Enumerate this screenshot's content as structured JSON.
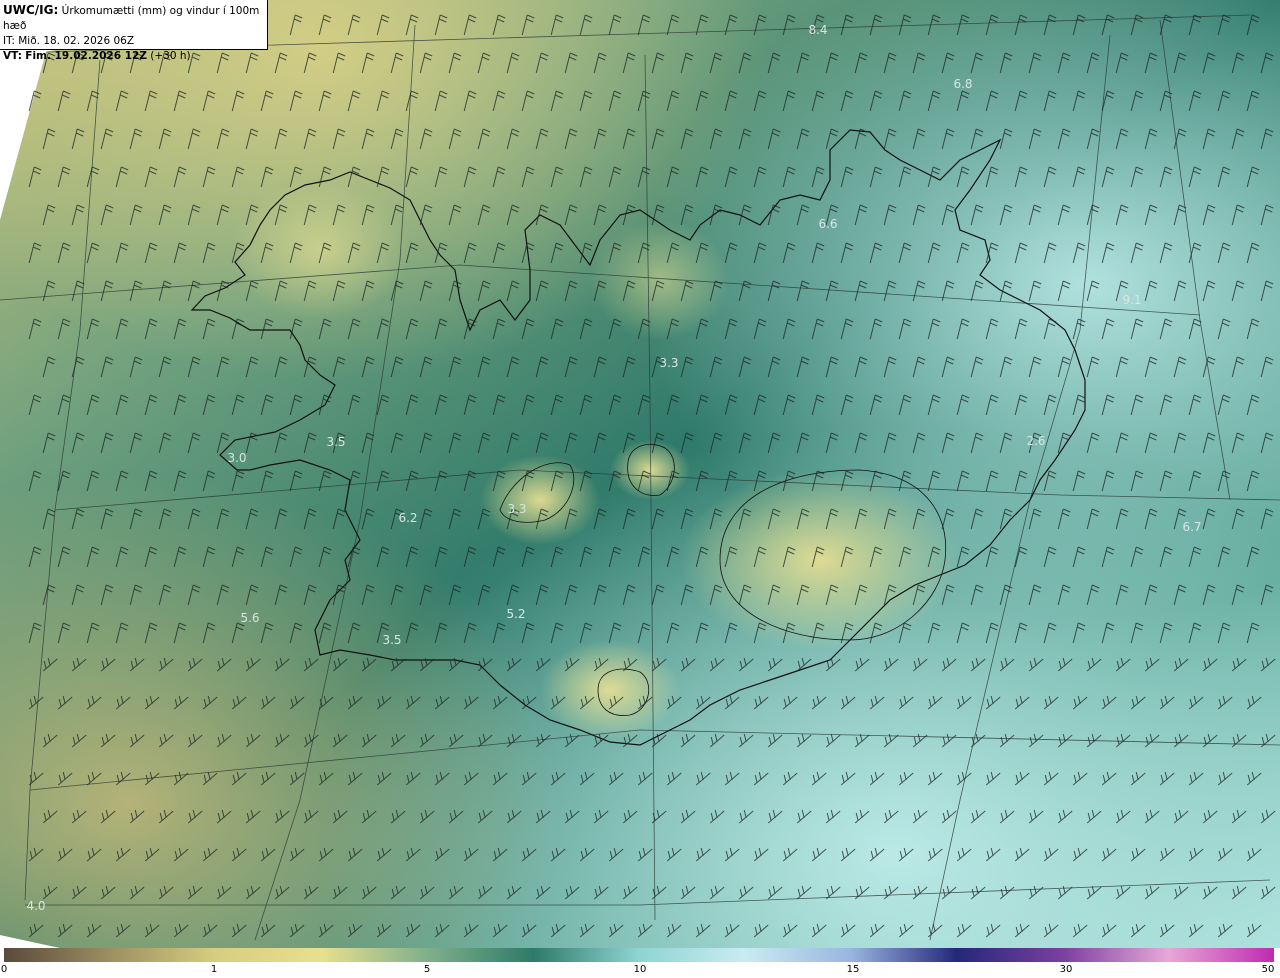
{
  "header": {
    "model": "UWC/IG:",
    "title": "Úrkomumætti (mm) og vindur í 100m hæð",
    "it_prefix": "IT:",
    "it_value": "Mið. 18. 02. 2026 06Z",
    "vt_prefix": "VT:",
    "vt_value": "Fim. 19.02.2026 12Z",
    "vt_lead": "(+30 h)"
  },
  "map_values": [
    "8.4",
    "6.8",
    "6.6",
    "9.1",
    "3.3",
    "2.6",
    "3.5",
    "3.0",
    "6.2",
    "3.3",
    "6.7",
    "5.6",
    "5.2",
    "3.5",
    "4.0"
  ],
  "colorbar": {
    "ticks": [
      "0",
      "1",
      "5",
      "10",
      "15",
      "30",
      "50"
    ],
    "colors": [
      "#5a4a3a",
      "#9c8f62",
      "#d8cd7f",
      "#e8df8f",
      "#7fb08a",
      "#2f7a6a",
      "#8fd3d3",
      "#c8ecf2",
      "#9ab5e0",
      "#24287a",
      "#7b3fa0",
      "#e6a8d8",
      "#c02ab0"
    ]
  },
  "colors": {
    "land_yellow": "#c9c67a",
    "sea_teal": "#2f7a6a",
    "light_cyan": "#9fd9d6"
  }
}
